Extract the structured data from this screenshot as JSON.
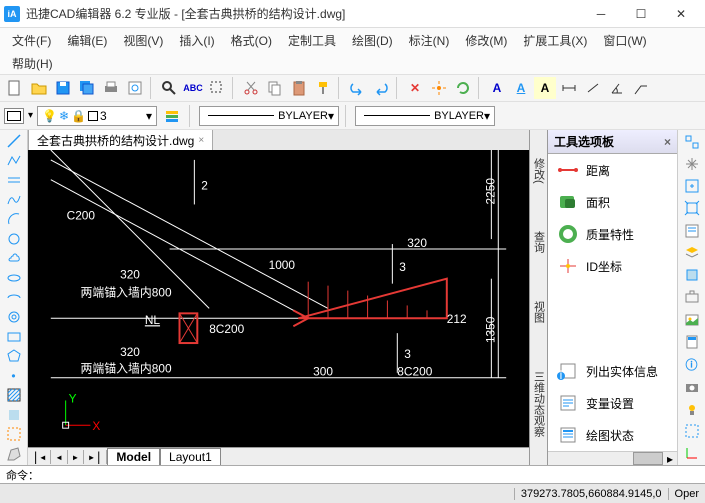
{
  "window": {
    "title": "迅捷CAD编辑器 6.2 专业版 - [全套古典拱桥的结构设计.dwg]",
    "app_icon_text": "iA"
  },
  "menu": {
    "items": [
      "文件(F)",
      "编辑(E)",
      "视图(V)",
      "插入(I)",
      "格式(O)",
      "定制工具",
      "绘图(D)",
      "标注(N)",
      "修改(M)",
      "扩展工具(X)",
      "窗口(W)"
    ],
    "help": "帮助(H)"
  },
  "layer": {
    "current": "3",
    "linetype": "BYLAYER",
    "lineweight": "BYLAYER"
  },
  "file_tab": {
    "name": "全套古典拱桥的结构设计.dwg"
  },
  "side_tabs": [
    "修改(",
    "查询",
    "视图",
    "三维动态观察"
  ],
  "tool_panel": {
    "title": "工具选项板",
    "items": [
      {
        "label": "距离",
        "color": "#e53935"
      },
      {
        "label": "面积",
        "color": "#4caf50"
      },
      {
        "label": "质量特性",
        "color": "#4caf50"
      },
      {
        "label": "ID坐标",
        "color": "#e53935"
      },
      {
        "label": "列出实体信息",
        "color": "#2196f3"
      },
      {
        "label": "变量设置",
        "color": "#2196f3"
      },
      {
        "label": "绘图状态",
        "color": "#2196f3"
      }
    ]
  },
  "layout_tabs": {
    "model": "Model",
    "layout1": "Layout1"
  },
  "drawing_labels": {
    "l2": "2",
    "l3a": "3",
    "l3b": "3",
    "d2250": "2250",
    "d1350": "1350",
    "dC200": "C200",
    "d320a": "320",
    "d320b": "320",
    "d320c": "320",
    "d1000": "1000",
    "d300": "300",
    "d212": "212",
    "d8a200a": "8C200",
    "d8a200b": "8C200",
    "nl": "NL",
    "wall1": "两端锚入墙内800",
    "wall2": "两端锚入墙内800",
    "y": "Y",
    "x": "X"
  },
  "commandline": "命令：",
  "status": {
    "coords": "379273.7805,660884.9145,0",
    "mode": "Oper"
  }
}
